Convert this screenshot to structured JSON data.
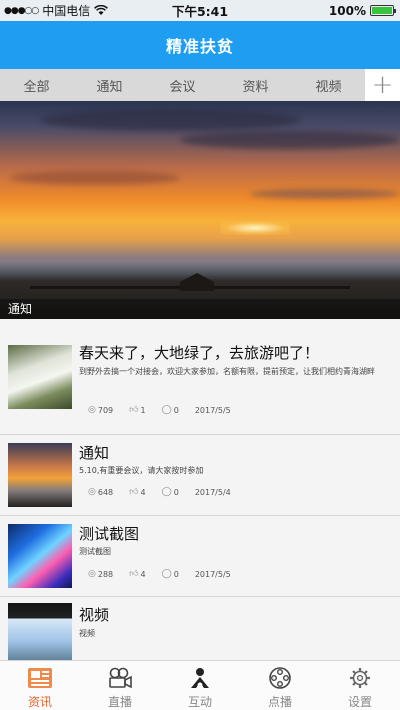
{
  "status_bar": {
    "signal": "●●●○○",
    "carrier": "中国电信",
    "wifi": "wifi-icon",
    "time": "下午5:41",
    "battery": "100%",
    "battery_level": 1.0
  },
  "header": {
    "title": "精准扶贫"
  },
  "tabs": [
    {
      "label": "全部"
    },
    {
      "label": "通知"
    },
    {
      "label": "会议"
    },
    {
      "label": "资料"
    },
    {
      "label": "视频"
    }
  ],
  "tab_add_label": "+",
  "banner": {
    "caption": "通知"
  },
  "articles": [
    {
      "title": "春天来了，大地绿了，去旅游吧了！",
      "desc": "到野外去搞一个对接会，欢迎大家参加，名额有限，提前预定，让我们相约青海湖畔",
      "views": "709",
      "likes": "1",
      "comments": "0",
      "date": "2017/5/5"
    },
    {
      "title": "通知",
      "desc": "5.10,有重要会议，请大家按时参加",
      "views": "648",
      "likes": "4",
      "comments": "0",
      "date": "2017/5/4"
    },
    {
      "title": "测试截图",
      "desc": "测试截图",
      "views": "288",
      "likes": "4",
      "comments": "0",
      "date": "2017/5/5"
    },
    {
      "title": "视频",
      "desc": "视频",
      "views": "",
      "likes": "",
      "comments": "",
      "date": ""
    }
  ],
  "tabbar": [
    {
      "label": "资讯",
      "icon": "news-icon",
      "active": true
    },
    {
      "label": "直播",
      "icon": "camera-icon",
      "active": false
    },
    {
      "label": "互动",
      "icon": "interact-icon",
      "active": false
    },
    {
      "label": "点播",
      "icon": "film-reel-icon",
      "active": false
    },
    {
      "label": "设置",
      "icon": "gear-icon",
      "active": false
    }
  ],
  "colors": {
    "header": "#1e9df1",
    "active_tab": "#e8662a",
    "battery": "#39c23d"
  }
}
